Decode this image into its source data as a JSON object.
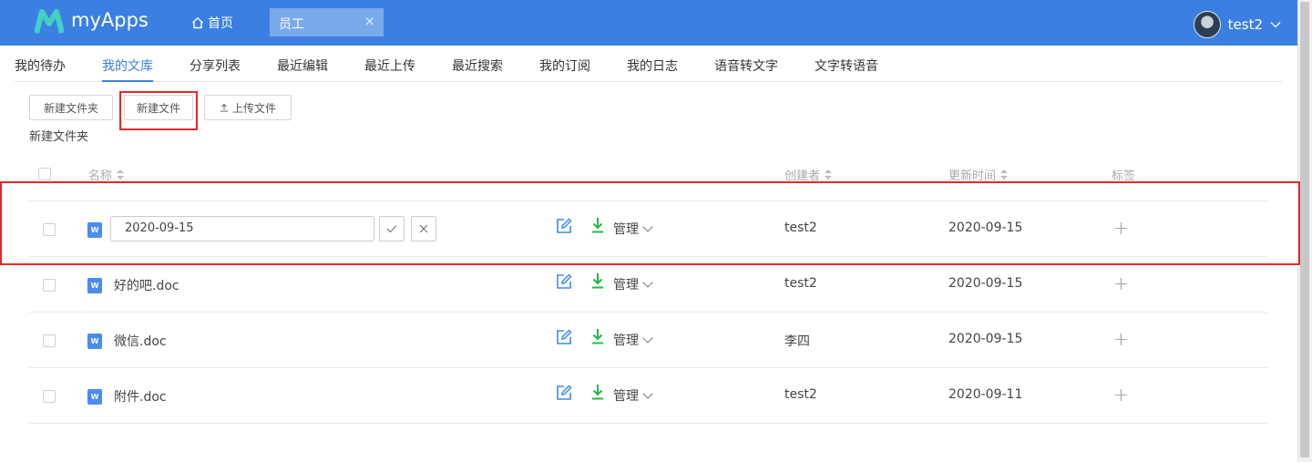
{
  "header": {
    "app_name": "myApps",
    "home_tab": "首页",
    "open_tab": "员工",
    "close_glyph": "×",
    "user_name": "test2",
    "color": "#3b7fe3"
  },
  "nav_tabs": [
    {
      "label": "我的待办",
      "active": false
    },
    {
      "label": "我的文库",
      "active": true
    },
    {
      "label": "分享列表",
      "active": false
    },
    {
      "label": "最近编辑",
      "active": false
    },
    {
      "label": "最近上传",
      "active": false
    },
    {
      "label": "最近搜索",
      "active": false
    },
    {
      "label": "我的订阅",
      "active": false
    },
    {
      "label": "我的日志",
      "active": false
    },
    {
      "label": "语音转文字",
      "active": false
    },
    {
      "label": "文字转语音",
      "active": false
    }
  ],
  "toolbar": {
    "new_folder": "新建文件夹",
    "new_file": "新建文件",
    "upload": "上传文件",
    "caption": "新建文件夹"
  },
  "table": {
    "columns": {
      "name": "名称",
      "creator": "创建者",
      "updated": "更新时间",
      "tags": "标签"
    },
    "edit_row": {
      "value": "2020-09-15",
      "creator": "test2",
      "updated": "2020-09-15"
    },
    "rows": [
      {
        "name": "好的吧.doc",
        "creator": "test2",
        "updated": "2020-09-15"
      },
      {
        "name": "微信.doc",
        "creator": "李四",
        "updated": "2020-09-15"
      },
      {
        "name": "附件.doc",
        "creator": "test2",
        "updated": "2020-09-11"
      }
    ],
    "manage_label": "管理",
    "file_badge": "W",
    "add_tag_glyph": "+"
  }
}
